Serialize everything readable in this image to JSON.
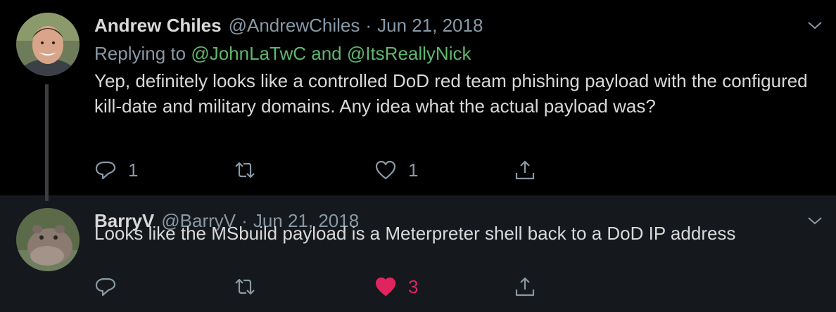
{
  "tweets": [
    {
      "author": "Andrew Chiles",
      "handle": "@AndrewChiles",
      "date": "Jun 21, 2018",
      "replying_prefix": "Replying to",
      "replying_to": "@JohnLaTwC and @ItsReallyNick",
      "text": "Yep, definitely looks like a controlled DoD red team phishing payload with the configured kill-date and military domains. Any idea what the actual payload was?",
      "reply_count": "1",
      "retweet_count": "",
      "like_count": "1",
      "liked": false
    },
    {
      "author": "BarryV",
      "handle": "@BarryV",
      "date": "Jun 21, 2018",
      "text": "Looks like the MSbuild payload is a Meterpreter shell back to a DoD IP address",
      "reply_count": "",
      "retweet_count": "",
      "like_count": "3",
      "liked": true
    }
  ],
  "separator": "·",
  "icons": {
    "reply": "reply-icon",
    "retweet": "retweet-icon",
    "like": "heart-icon",
    "share": "share-icon",
    "more": "chevron-down-icon"
  },
  "colors": {
    "background": "#000000",
    "reply_background": "#15181c",
    "text": "#d9d9d9",
    "muted": "#8899a6",
    "mention": "#5fb76e",
    "like_active": "#e0245e"
  }
}
